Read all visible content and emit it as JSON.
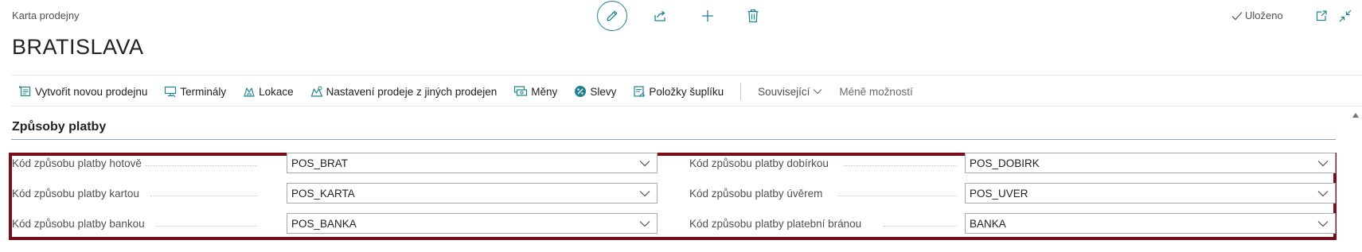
{
  "header": {
    "breadcrumb": "Karta prodejny",
    "title": "BRATISLAVA",
    "status": "Uloženo"
  },
  "colors": {
    "accent": "#1f8291",
    "highlight_border": "#7a0d1c"
  },
  "toolbar": {
    "items": [
      {
        "label": "Vytvořit novou prodejnu",
        "icon": "new-store-icon"
      },
      {
        "label": "Terminály",
        "icon": "terminal-icon"
      },
      {
        "label": "Lokace",
        "icon": "location-icon"
      },
      {
        "label": "Nastavení prodeje z jiných prodejen",
        "icon": "stores-settings-icon"
      },
      {
        "label": "Měny",
        "icon": "currency-icon"
      },
      {
        "label": "Slevy",
        "icon": "discount-icon"
      },
      {
        "label": "Položky šuplíku",
        "icon": "drawer-items-icon"
      }
    ],
    "related": "Související",
    "fewer": "Méně možností"
  },
  "section": {
    "title": "Způsoby platby",
    "left_fields": [
      {
        "label": "Kód způsobu platby hotově",
        "value": "POS_BRAT"
      },
      {
        "label": "Kód způsobu platby kartou",
        "value": "POS_KARTA"
      },
      {
        "label": "Kód způsobu platby bankou",
        "value": "POS_BANKA"
      }
    ],
    "right_fields": [
      {
        "label": "Kód způsobu platby dobírkou",
        "value": "POS_DOBIRK"
      },
      {
        "label": "Kód způsobu platby úvěrem",
        "value": "POS_UVER"
      },
      {
        "label": "Kód způsobu platby platební bránou",
        "value": "BANKA"
      }
    ]
  }
}
